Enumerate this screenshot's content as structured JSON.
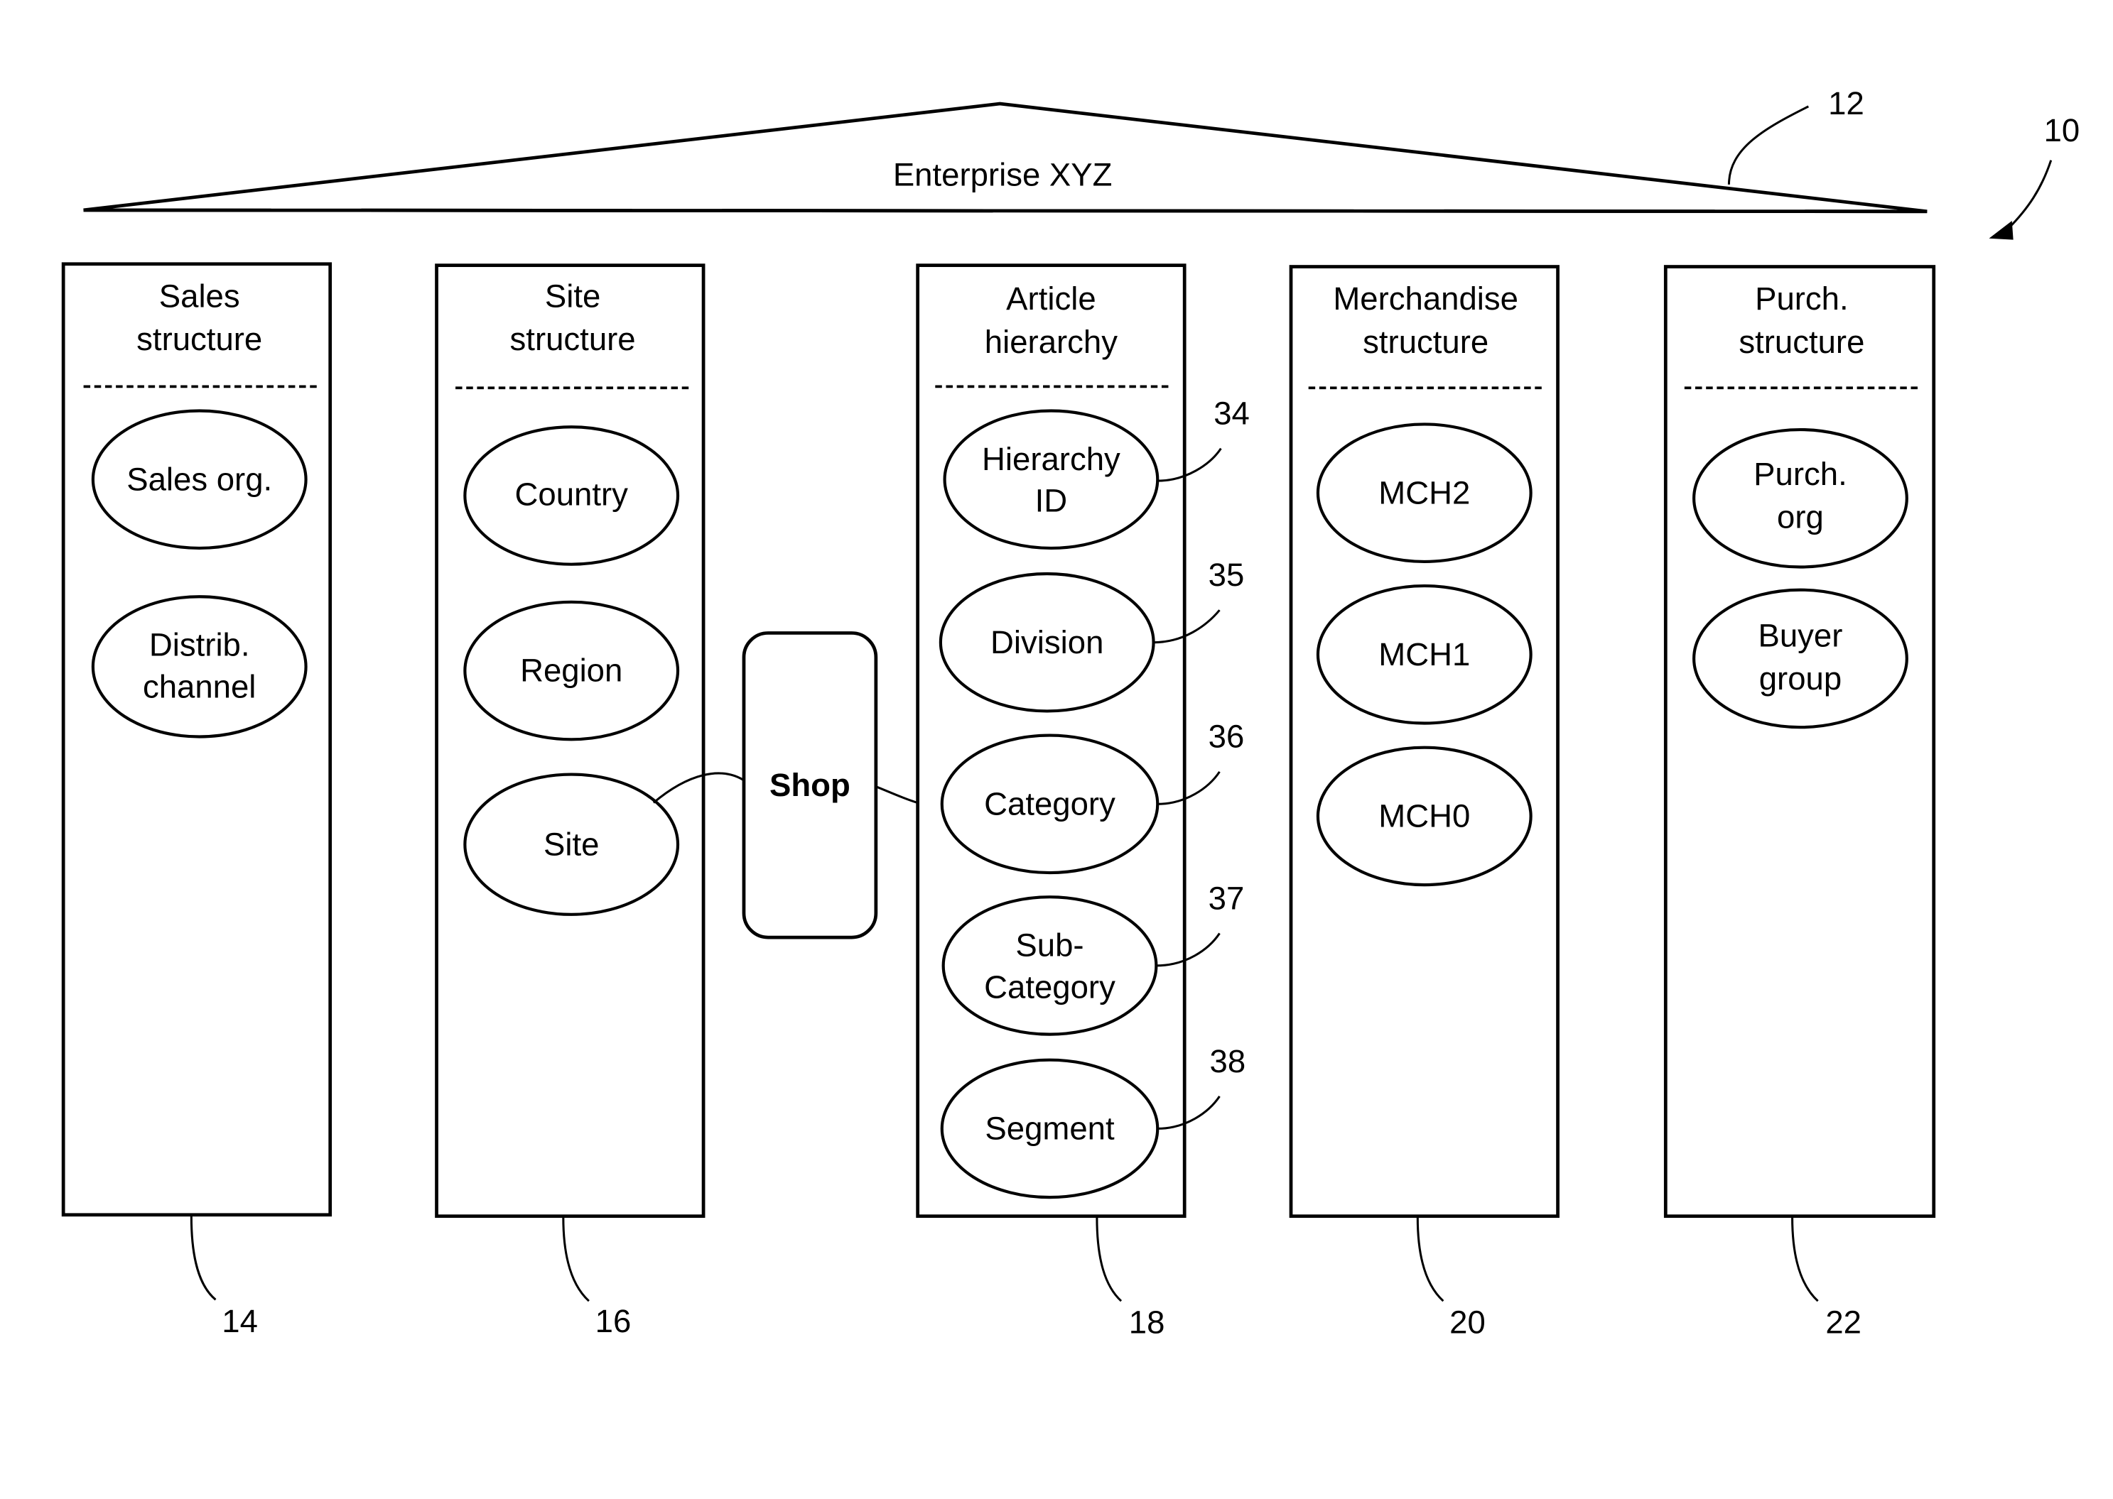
{
  "figure": {
    "reference_number": "10",
    "enterprise": {
      "label": "Enterprise XYZ",
      "reference": "12"
    },
    "columns": [
      {
        "id": "sales",
        "title_lines": [
          "Sales",
          "structure"
        ],
        "reference": "14",
        "nodes": [
          {
            "lines": [
              "Sales org."
            ]
          },
          {
            "lines": [
              "Distrib.",
              "channel"
            ]
          }
        ]
      },
      {
        "id": "site",
        "title_lines": [
          "Site",
          "structure"
        ],
        "reference": "16",
        "nodes": [
          {
            "lines": [
              "Country"
            ]
          },
          {
            "lines": [
              "Region"
            ]
          },
          {
            "lines": [
              "Site"
            ]
          }
        ]
      },
      {
        "id": "article",
        "title_lines": [
          "Article",
          "hierarchy"
        ],
        "reference": "18",
        "nodes": [
          {
            "lines": [
              "Hierarchy",
              "ID"
            ],
            "reference": "34"
          },
          {
            "lines": [
              "Division"
            ],
            "reference": "35"
          },
          {
            "lines": [
              "Category"
            ],
            "reference": "36"
          },
          {
            "lines": [
              "Sub-",
              "Category"
            ],
            "reference": "37"
          },
          {
            "lines": [
              "Segment"
            ],
            "reference": "38"
          }
        ]
      },
      {
        "id": "merchandise",
        "title_lines": [
          "Merchandise",
          "structure"
        ],
        "reference": "20",
        "nodes": [
          {
            "lines": [
              "MCH2"
            ]
          },
          {
            "lines": [
              "MCH1"
            ]
          },
          {
            "lines": [
              "MCH0"
            ]
          }
        ]
      },
      {
        "id": "purch",
        "title_lines": [
          "Purch.",
          "structure"
        ],
        "reference": "22",
        "nodes": [
          {
            "lines": [
              "Purch.",
              "org"
            ]
          },
          {
            "lines": [
              "Buyer",
              "group"
            ]
          }
        ]
      }
    ],
    "shop": {
      "label": "Shop",
      "connects": [
        "Site",
        "Category"
      ]
    }
  }
}
